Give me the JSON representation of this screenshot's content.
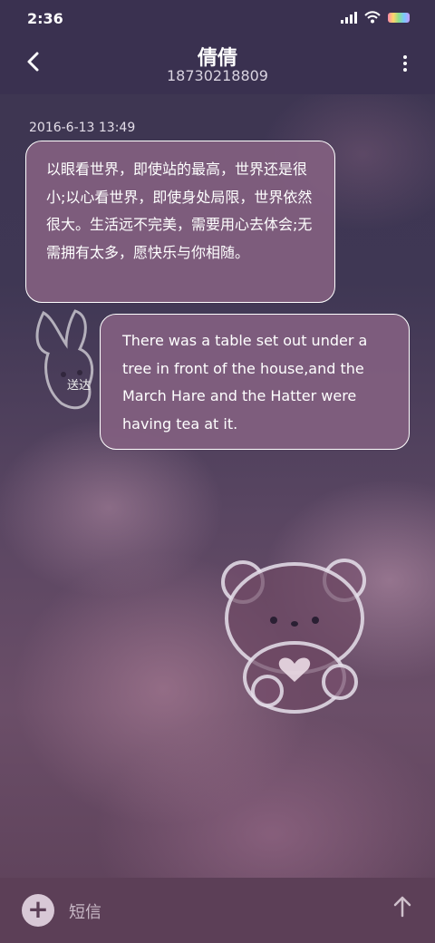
{
  "status": {
    "time": "2:36"
  },
  "header": {
    "title": "倩倩",
    "subtitle": "18730218809"
  },
  "conversation": {
    "timestamp": "2016-6-13 13:49",
    "incoming": "以眼看世界，即使站的最高，世界还是很小;以心看世界，即使身处局限，世界依然很大。生活远不完美，需要用心去体会;无需拥有太多，愿快乐与你相随。",
    "outgoing": "There was a table set out under a tree in front of the house,and the March Hare and the Hatter were having tea at it.",
    "sent_label": "送达"
  },
  "composer": {
    "placeholder": "短信"
  },
  "icons": {
    "back": "chevron-left-icon",
    "more": "more-vertical-icon",
    "add": "plus-icon",
    "send": "arrow-up-icon"
  }
}
